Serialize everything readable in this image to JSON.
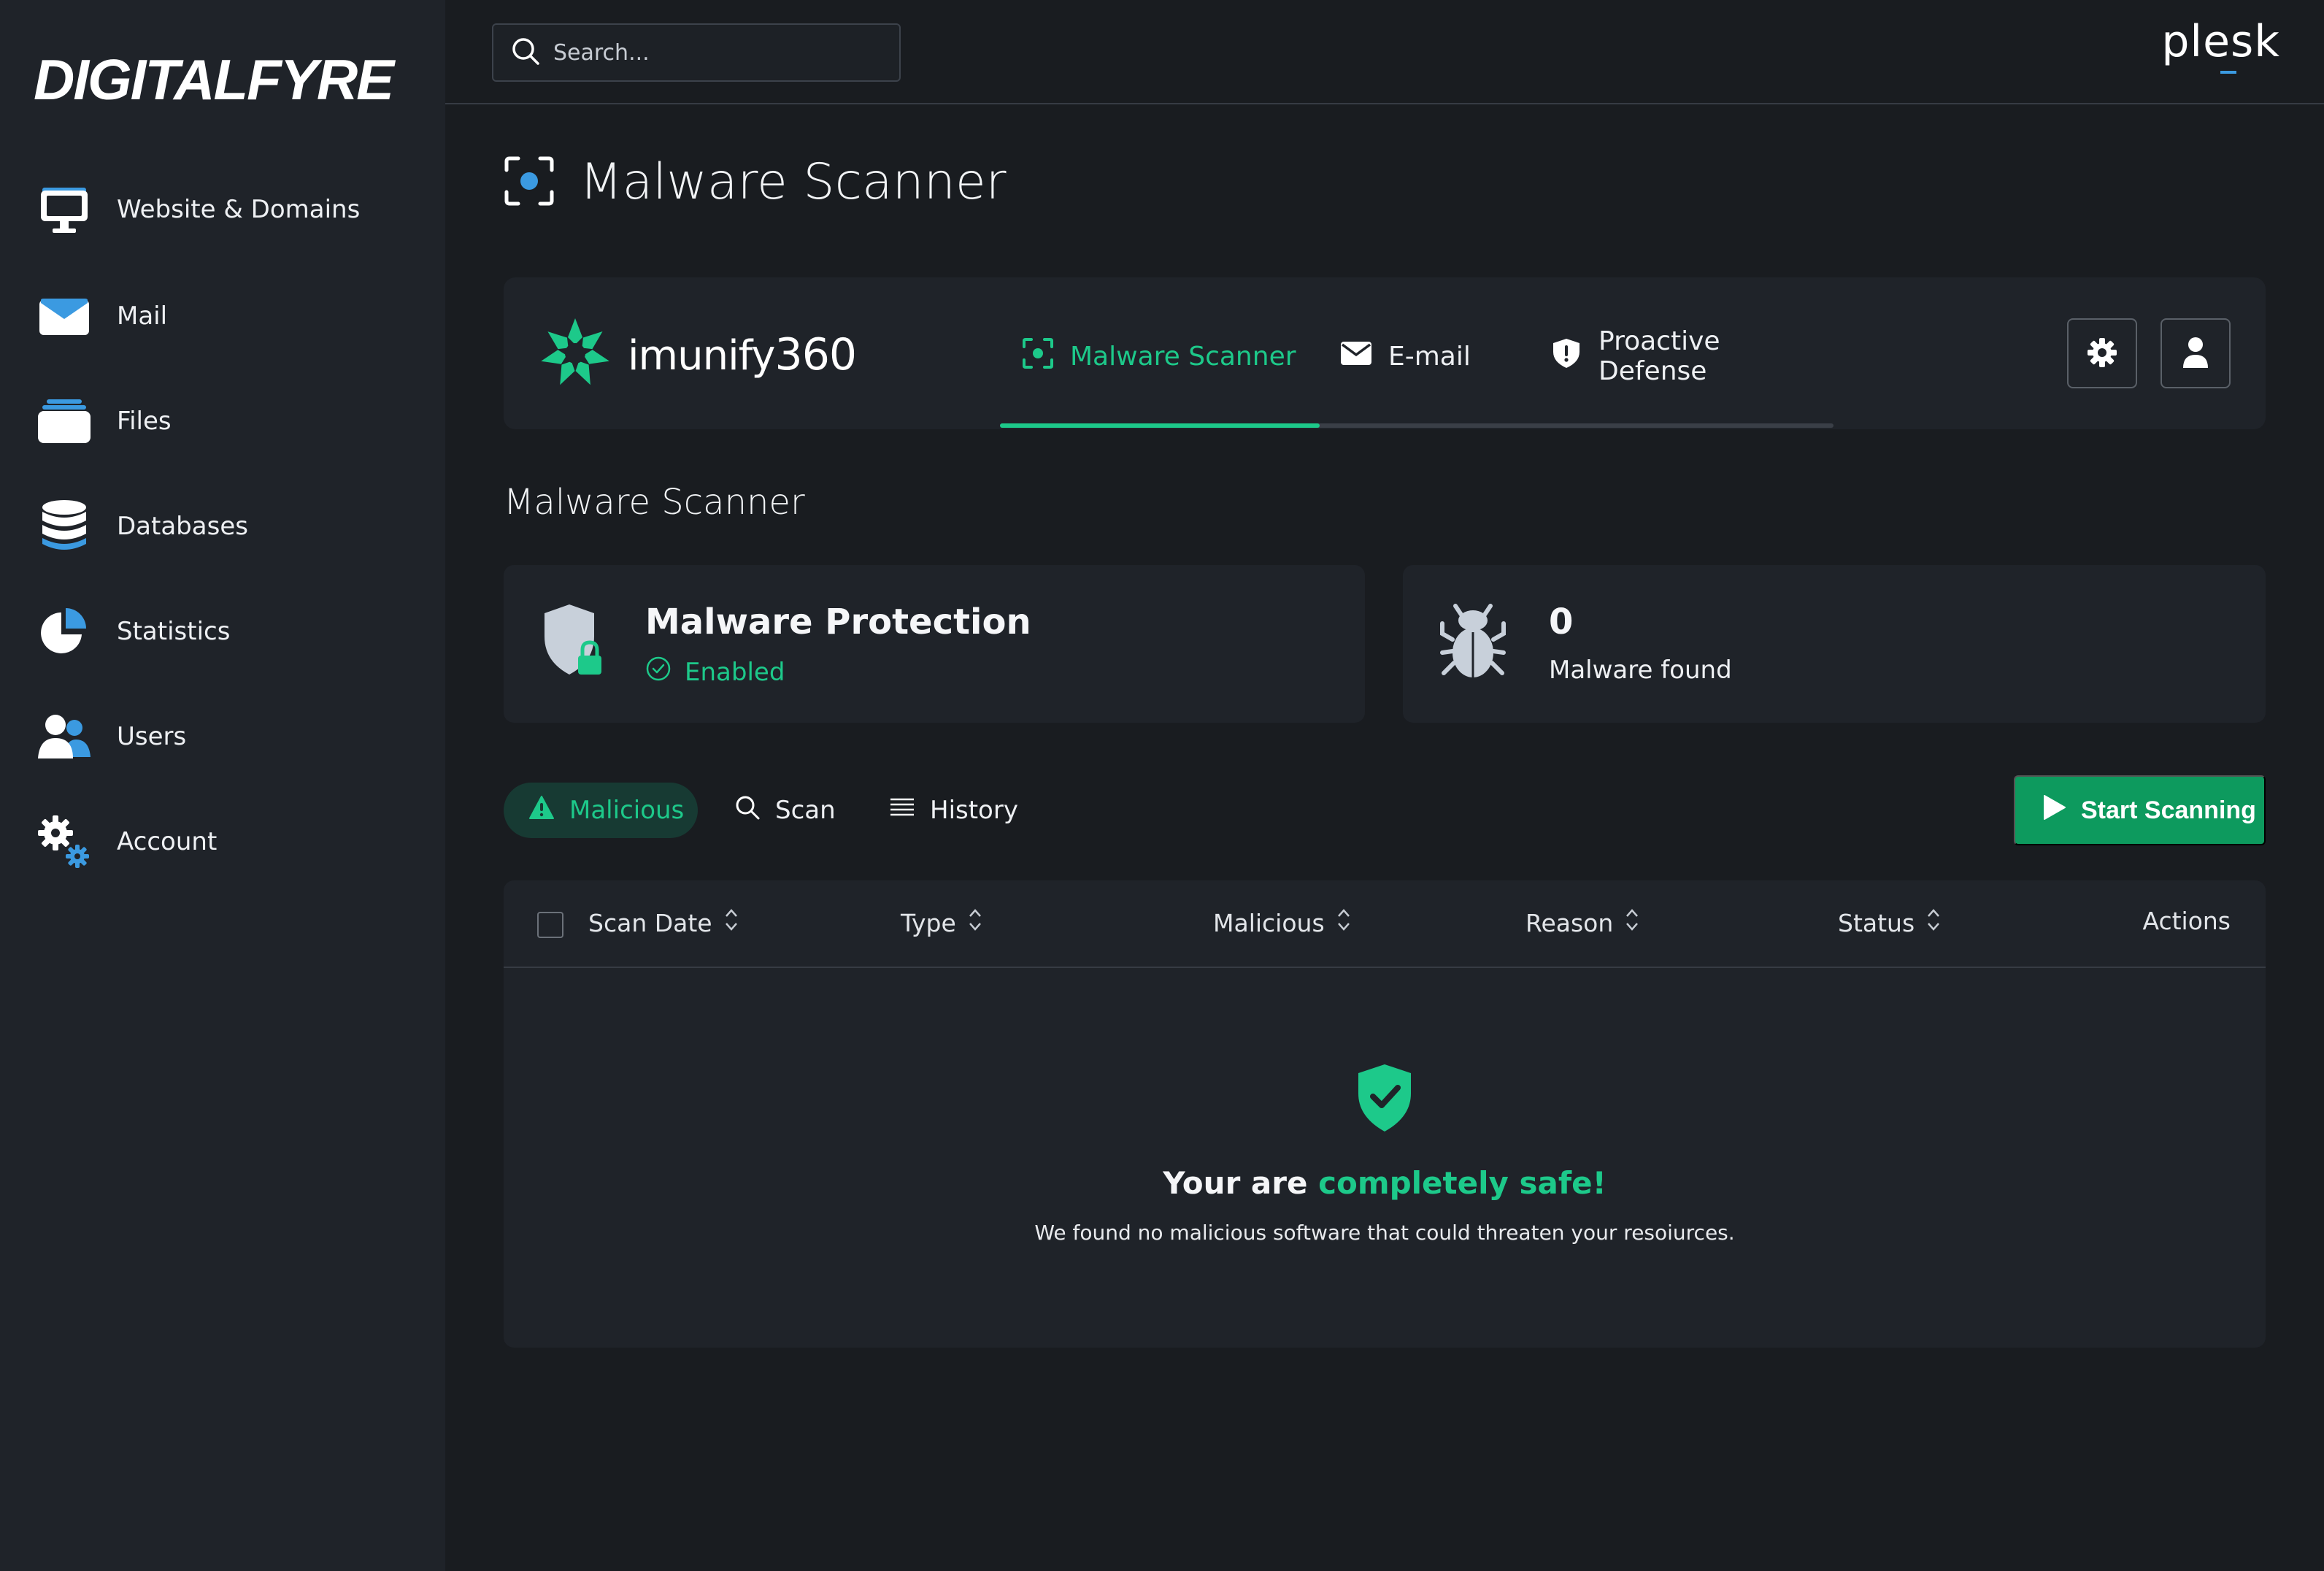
{
  "brand": {
    "name": "DIGITALFYRE"
  },
  "sidebar": {
    "items": [
      {
        "label": "Website & Domains",
        "icon": "monitor-icon"
      },
      {
        "label": "Mail",
        "icon": "envelope-icon"
      },
      {
        "label": "Files",
        "icon": "files-icon"
      },
      {
        "label": "Databases",
        "icon": "database-icon"
      },
      {
        "label": "Statistics",
        "icon": "pie-chart-icon"
      },
      {
        "label": "Users",
        "icon": "users-icon"
      },
      {
        "label": "Account",
        "icon": "gears-icon"
      }
    ]
  },
  "topbar": {
    "search_placeholder": "Search...",
    "plesk_logo": "plesk"
  },
  "page": {
    "title": "Malware Scanner"
  },
  "imunify": {
    "logo_text": "imunify",
    "logo_num": "360",
    "tabs": [
      {
        "label": "Malware Scanner",
        "active": true
      },
      {
        "label": "E-mail",
        "active": false
      },
      {
        "label": "Proactive Defense",
        "active": false
      }
    ]
  },
  "section": {
    "title": "Malware Scanner"
  },
  "protection_card": {
    "title": "Malware Protection",
    "status": "Enabled"
  },
  "malware_card": {
    "count": "0",
    "label": "Malware found"
  },
  "filters": {
    "malicious": "Malicious",
    "scan": "Scan",
    "history": "History",
    "start_button": "Start Scanning"
  },
  "table": {
    "columns": [
      "Scan Date",
      "Type",
      "Malicious",
      "Reason",
      "Status",
      "Actions"
    ]
  },
  "empty_state": {
    "lead": "Your are ",
    "highlight": "completely safe!",
    "description": "We found no malicious software that could threaten your resoiurces."
  },
  "colors": {
    "accent": "#1dc98a",
    "accent_dark": "#0d9a5e",
    "background": "#191c20",
    "panel": "#1f2329",
    "icon_blue": "#3b9ae1"
  }
}
